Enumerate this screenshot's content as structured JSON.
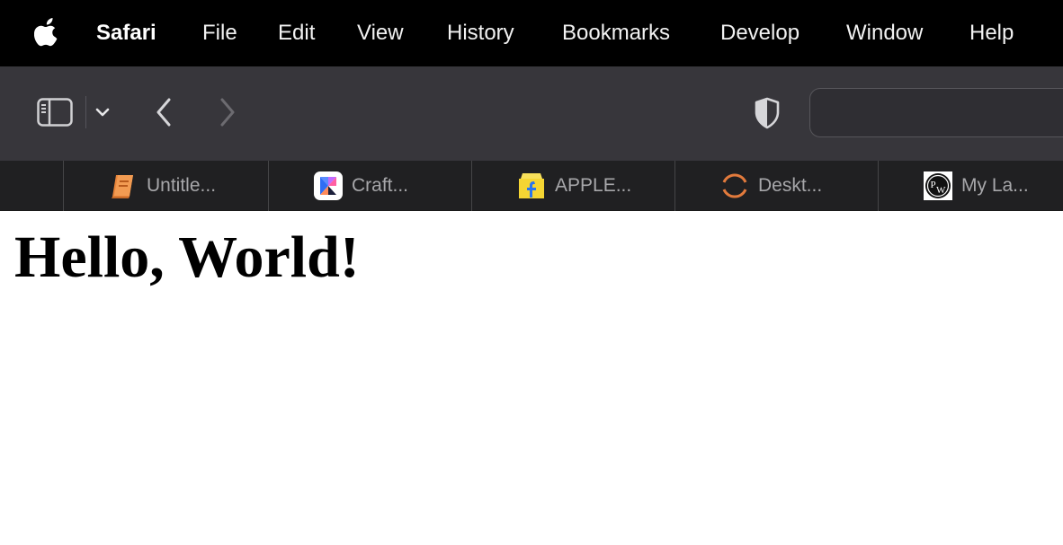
{
  "menubar": {
    "app_name": "Safari",
    "items": [
      "File",
      "Edit",
      "View",
      "History",
      "Bookmarks",
      "Develop",
      "Window",
      "Help"
    ]
  },
  "toolbar": {
    "address_value": ""
  },
  "tabs": [
    {
      "label": "Untitle...",
      "icon": "notebook-icon"
    },
    {
      "label": "Craft...",
      "icon": "craft-app-icon"
    },
    {
      "label": "APPLE...",
      "icon": "flipkart-icon"
    },
    {
      "label": "Deskt...",
      "icon": "desktop-ring-icon"
    },
    {
      "label": "My La...",
      "icon": "pw-logo-icon"
    }
  ],
  "page": {
    "heading": "Hello, World!"
  },
  "colors": {
    "menubar_bg": "#000000",
    "toolbar_bg": "#37363b",
    "tabbar_bg": "#202022",
    "tab_text": "#a7a7aa"
  }
}
